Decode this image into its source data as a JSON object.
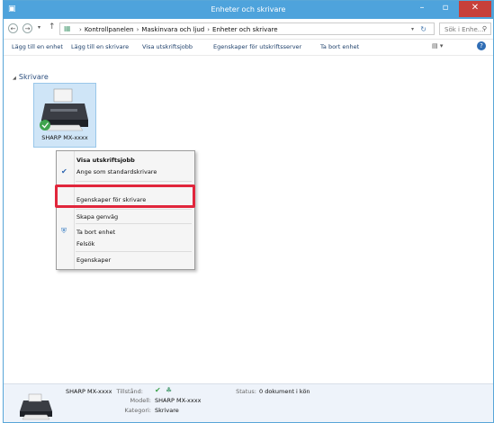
{
  "window": {
    "title": "Enheter och skrivare"
  },
  "address": {
    "crumbs": [
      "Kontrollpanelen",
      "Maskinvara och ljud",
      "Enheter och skrivare"
    ],
    "search_placeholder": "Sök i Enhe..."
  },
  "toolbar": {
    "items": [
      "Lägg till en enhet",
      "Lägg till en skrivare",
      "Visa utskriftsjobb",
      "Egenskaper för utskriftsserver",
      "Ta bort enhet"
    ]
  },
  "content": {
    "group_header": "Skrivare",
    "printer_name": "SHARP MX-xxxx"
  },
  "context_menu": {
    "items": [
      "Visa utskriftsjobb",
      "Ange som standardskrivare",
      "Egenskaper för skrivare",
      "Skapa genväg",
      "Ta bort enhet",
      "Felsök",
      "Egenskaper"
    ]
  },
  "status": {
    "name": "SHARP MX-xxxx",
    "state_label": "Tillstånd:",
    "model_label": "Modell:",
    "model": "SHARP MX-xxxx",
    "category_label": "Kategori:",
    "category": "Skrivare",
    "status_label": "Status:",
    "status_value": "0 dokument i kön"
  },
  "colors": {
    "titlebar": "#4ea3dc",
    "selection": "#cfe5f7",
    "highlight": "#e1263c"
  }
}
